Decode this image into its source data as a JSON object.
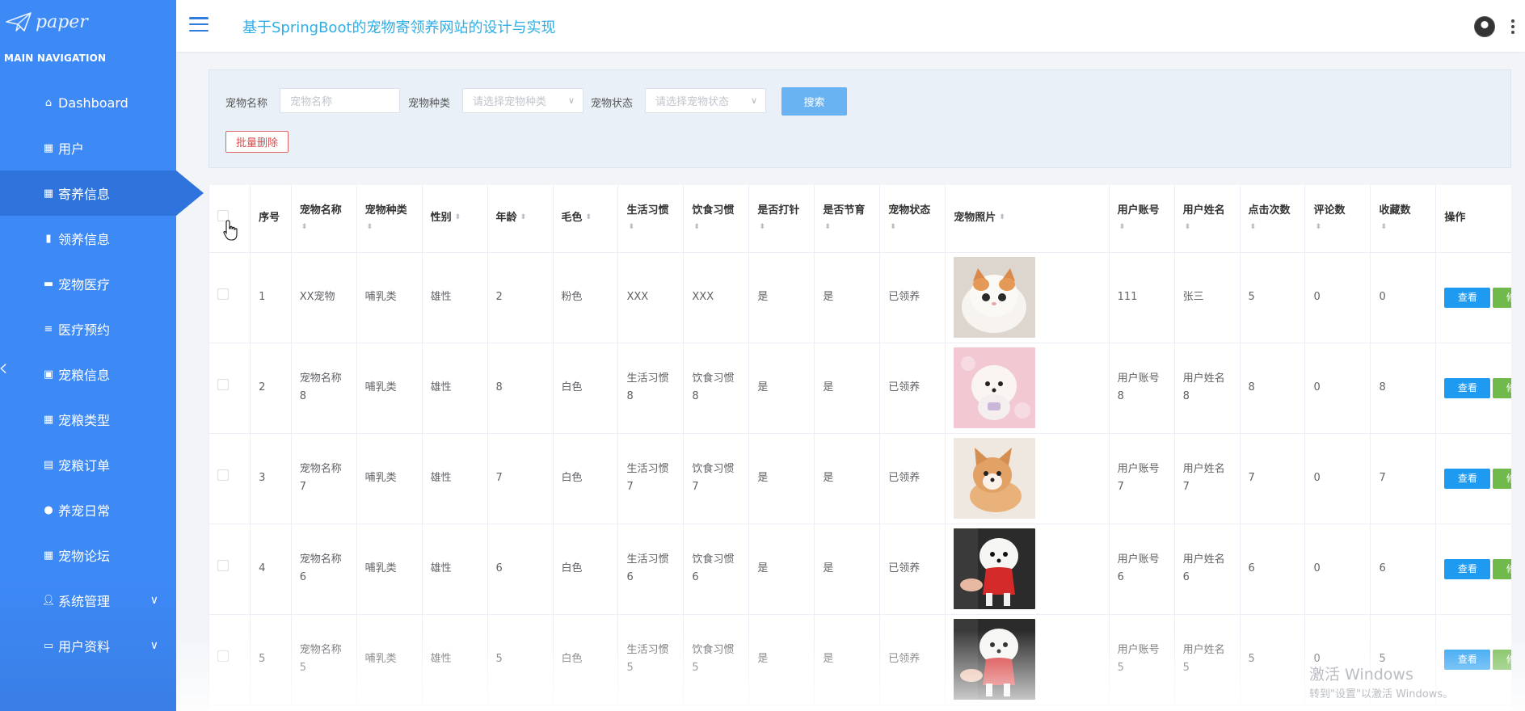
{
  "app": {
    "logo_text": "paper",
    "title": "基于SpringBoot的宠物寄领养网站的设计与实现"
  },
  "sidebar": {
    "section_title": "MAIN NAVIGATION",
    "items": [
      {
        "label": "Dashboard",
        "icon": "home-icon"
      },
      {
        "label": "用户",
        "icon": "grid-icon"
      },
      {
        "label": "寄养信息",
        "icon": "grid-icon"
      },
      {
        "label": "领养信息",
        "icon": "bar-chart-icon"
      },
      {
        "label": "宠物医疗",
        "icon": "briefcase-icon"
      },
      {
        "label": "医疗预约",
        "icon": "list-icon"
      },
      {
        "label": "宠粮信息",
        "icon": "picture-icon"
      },
      {
        "label": "宠粮类型",
        "icon": "grid-icon"
      },
      {
        "label": "宠粮订单",
        "icon": "clipboard-icon"
      },
      {
        "label": "养宠日常",
        "icon": "bulb-icon"
      },
      {
        "label": "宠物论坛",
        "icon": "grid-icon"
      },
      {
        "label": "系统管理",
        "icon": "user-icon"
      },
      {
        "label": "用户资料",
        "icon": "card-icon"
      }
    ],
    "active_index": 2
  },
  "search": {
    "name_label": "宠物名称",
    "name_placeholder": "宠物名称",
    "type_label": "宠物种类",
    "type_placeholder": "请选择宠物种类",
    "status_label": "宠物状态",
    "status_placeholder": "请选择宠物状态",
    "search_button": "搜索",
    "batch_delete_button": "批量删除"
  },
  "table": {
    "headers": [
      "序号",
      "宠物名称",
      "宠物种类",
      "性别",
      "年龄",
      "毛色",
      "生活习惯",
      "饮食习惯",
      "是否打针",
      "是否节育",
      "宠物状态",
      "宠物照片",
      "用户账号",
      "用户姓名",
      "点击次数",
      "评论数",
      "收藏数",
      "操作"
    ],
    "view_label": "查看",
    "edit_label": "修改",
    "rows": [
      {
        "no": "1",
        "name": "XX宠物",
        "type": "哺乳类",
        "gender": "雄性",
        "age": "2",
        "color": "粉色",
        "habit": "XXX",
        "diet": "XXX",
        "vaccinated": "是",
        "sterilized": "是",
        "status": "已领养",
        "photo": "white-orange-kitten",
        "account": "111",
        "username": "张三",
        "clicks": "5",
        "comments": "0",
        "favorites": "0"
      },
      {
        "no": "2",
        "name": "宠物名称8",
        "type": "哺乳类",
        "gender": "雄性",
        "age": "8",
        "color": "白色",
        "habit": "生活习惯8",
        "diet": "饮食习惯8",
        "vaccinated": "是",
        "sterilized": "是",
        "status": "已领养",
        "photo": "pomeranian-pink",
        "account": "用户账号8",
        "username": "用户姓名8",
        "clicks": "8",
        "comments": "0",
        "favorites": "8"
      },
      {
        "no": "3",
        "name": "宠物名称7",
        "type": "哺乳类",
        "gender": "雄性",
        "age": "7",
        "color": "白色",
        "habit": "生活习惯7",
        "diet": "饮食习惯7",
        "vaccinated": "是",
        "sterilized": "是",
        "status": "已领养",
        "photo": "corgi-puppy",
        "account": "用户账号7",
        "username": "用户姓名7",
        "clicks": "7",
        "comments": "0",
        "favorites": "7"
      },
      {
        "no": "4",
        "name": "宠物名称6",
        "type": "哺乳类",
        "gender": "雄性",
        "age": "6",
        "color": "白色",
        "habit": "生活习惯6",
        "diet": "饮食习惯6",
        "vaccinated": "是",
        "sterilized": "是",
        "status": "已领养",
        "photo": "white-puppy-red-outfit",
        "account": "用户账号6",
        "username": "用户姓名6",
        "clicks": "6",
        "comments": "0",
        "favorites": "6"
      },
      {
        "no": "5",
        "name": "宠物名称5",
        "type": "哺乳类",
        "gender": "雄性",
        "age": "5",
        "color": "白色",
        "habit": "生活习惯5",
        "diet": "饮食习惯5",
        "vaccinated": "是",
        "sterilized": "是",
        "status": "已领养",
        "photo": "white-puppy-red-outfit",
        "account": "用户账号5",
        "username": "用户姓名5",
        "clicks": "5",
        "comments": "0",
        "favorites": "5"
      }
    ]
  },
  "watermark": {
    "title": "激活 Windows",
    "subtitle": "转到\"设置\"以激活 Windows。"
  },
  "colors": {
    "sidebar": "#3d8af7",
    "sidebar_active": "#2f74dc",
    "title": "#2eaee6",
    "view_button": "#1e9af0",
    "edit_button": "#6fba4a",
    "danger": "#e04848"
  }
}
